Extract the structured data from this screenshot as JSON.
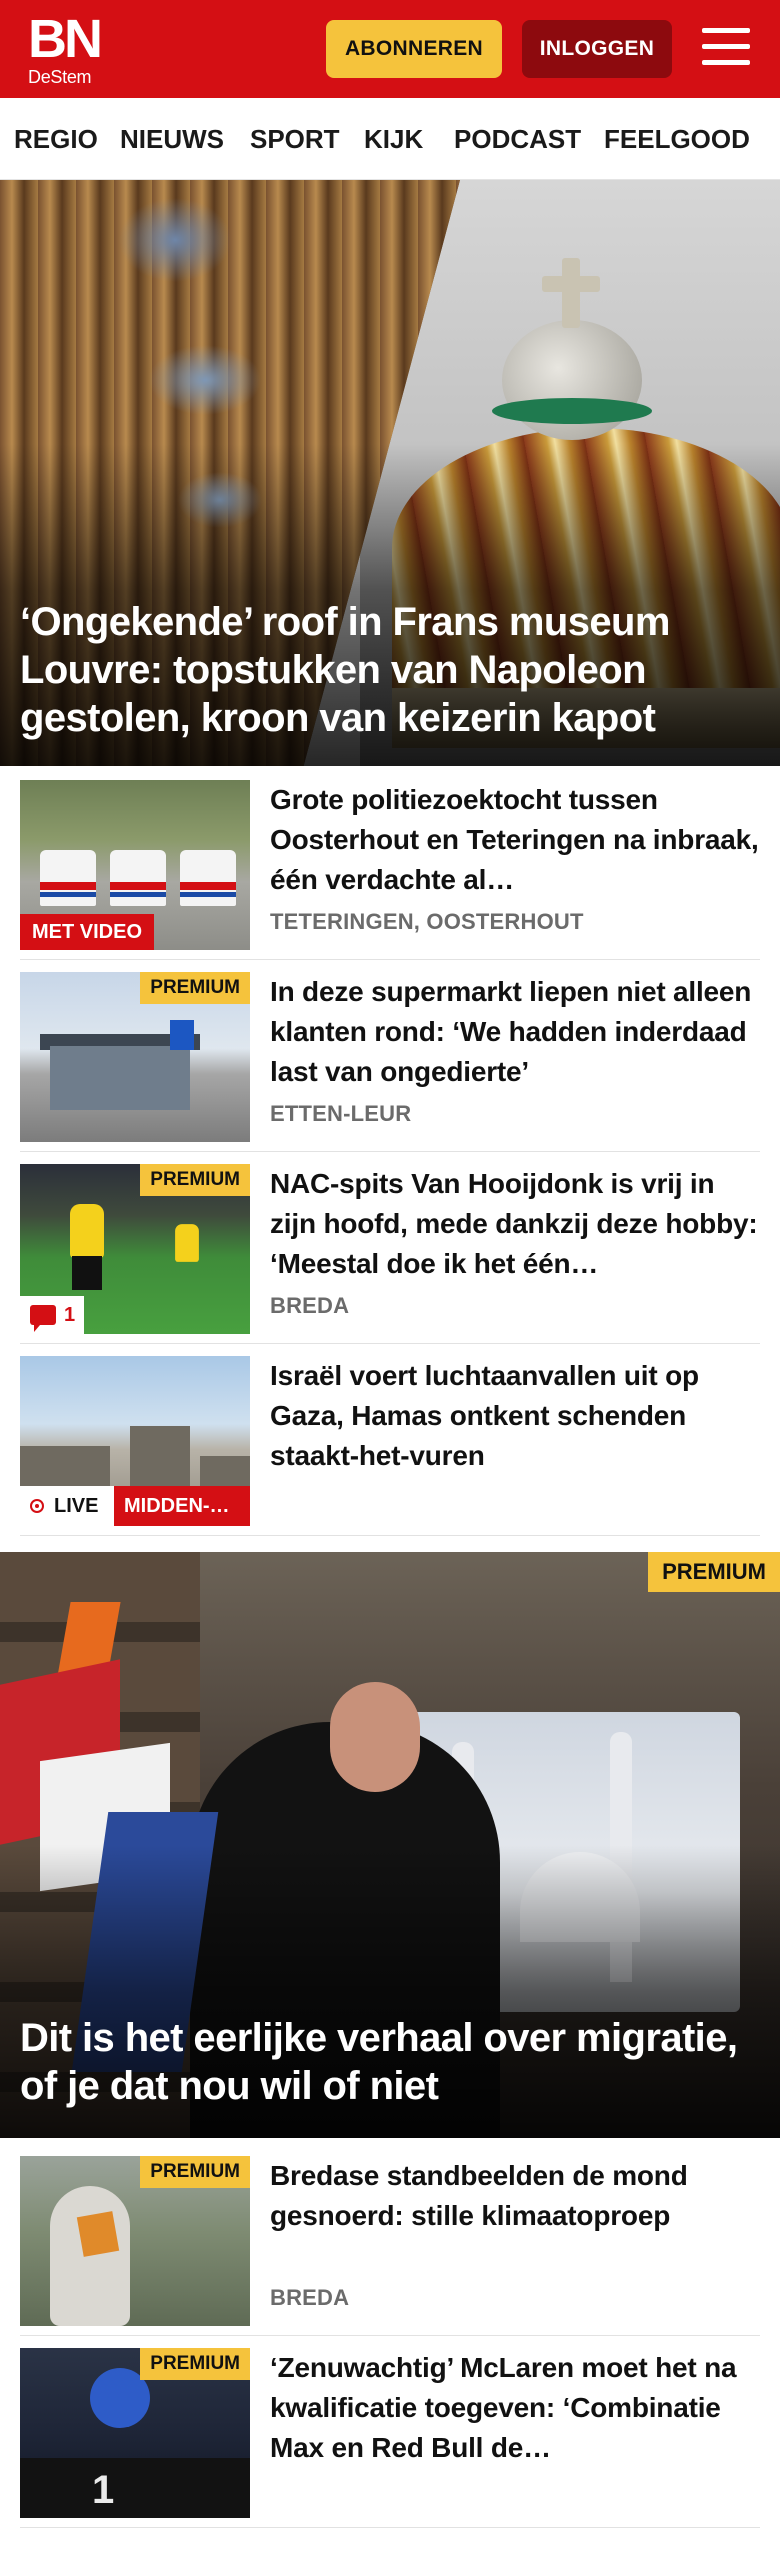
{
  "header": {
    "logo_main": "BN",
    "logo_sub": "DeStem",
    "subscribe_label": "ABONNEREN",
    "login_label": "INLOGGEN"
  },
  "nav": {
    "items": [
      "REGIO",
      "NIEUWS",
      "SPORT",
      "KIJK",
      "PODCAST",
      "FEELGOOD"
    ]
  },
  "hero": {
    "title": "‘Ongekende’ roof in Frans museum Louvre: topstukken van Napoleon gestolen, kroon van keizerin kapot"
  },
  "articles": [
    {
      "title": "Grote politiezoektocht tussen Oosterhout en Teteringen na inbraak, één verdachte al…",
      "location": "TETERINGEN, OOSTERHOUT",
      "badge_video": "MET VIDEO"
    },
    {
      "title": "In deze supermarkt liepen niet alleen klanten rond: ‘We hadden inderdaad last van ongedierte’",
      "location": "ETTEN-LEUR",
      "badge_premium": "PREMIUM"
    },
    {
      "title": "NAC-spits Van Hooijdonk is vrij in zijn hoofd, mede dankzij deze hobby: ‘Meestal doe ik het één…",
      "location": "BREDA",
      "badge_premium": "PREMIUM",
      "comments": "1"
    },
    {
      "title": "Israël voert luchtaanvallen uit op Gaza, Hamas ontkent schenden staakt-het-vuren",
      "live_label": "LIVE",
      "region_label": "MIDDEN-…"
    }
  ],
  "feature": {
    "badge_premium": "PREMIUM",
    "title": "Dit is het eerlijke verhaal over migratie, of je dat nou wil of niet"
  },
  "articles2": [
    {
      "title": "Bredase standbeelden de mond gesnoerd: stille klimaatoproep",
      "location": "BREDA",
      "badge_premium": "PREMIUM"
    },
    {
      "title": "‘Zenuwachtig’ McLaren moet het na kwalificatie toegeven: ‘Combinatie Max en Red Bull de…",
      "badge_premium": "PREMIUM",
      "thumb_number": "1"
    }
  ],
  "colors": {
    "brand_red": "#d40f14",
    "premium_yellow": "#f5c33c",
    "login_dark_red": "#8d0a0e"
  }
}
